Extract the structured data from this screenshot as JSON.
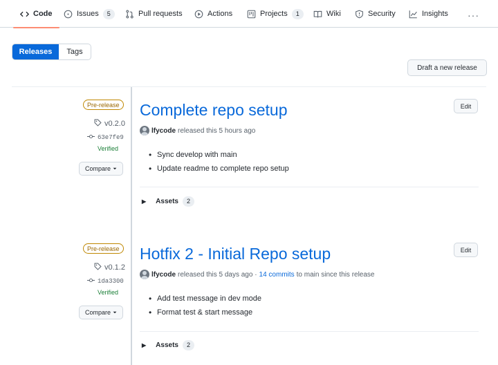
{
  "nav": {
    "code": "Code",
    "issues": "Issues",
    "issues_count": "5",
    "pulls": "Pull requests",
    "actions": "Actions",
    "projects": "Projects",
    "projects_count": "1",
    "wiki": "Wiki",
    "security": "Security",
    "insights": "Insights",
    "more": "···"
  },
  "subnav": {
    "releases": "Releases",
    "tags": "Tags"
  },
  "draft_button": "Draft a new release",
  "releases": [
    {
      "badge": "Pre-release",
      "tag": "v0.2.0",
      "commit": "63e7fe9",
      "verified": "Verified",
      "compare": "Compare",
      "title": "Complete repo setup",
      "author": "lfycode",
      "released": "released this 5 hours ago",
      "commits_link": "",
      "commits_suffix": "",
      "edit": "Edit",
      "notes": [
        "Sync develop with main",
        "Update readme to complete repo setup"
      ],
      "assets_label": "Assets",
      "assets_count": "2"
    },
    {
      "badge": "Pre-release",
      "tag": "v0.1.2",
      "commit": "1da3300",
      "verified": "Verified",
      "compare": "Compare",
      "title": "Hotfix 2 - Initial Repo setup",
      "author": "lfycode",
      "released": "released this 5 days ago ·",
      "commits_link": "14 commits",
      "commits_suffix": "to main since this release",
      "edit": "Edit",
      "notes": [
        "Add test message in dev mode",
        "Format test & start message"
      ],
      "assets_label": "Assets",
      "assets_count": "2"
    }
  ],
  "colors": {
    "accent": "#0969da",
    "prerelease": "#9a6700",
    "verified": "#1a7f37",
    "active_tab": "#fd8c73"
  }
}
